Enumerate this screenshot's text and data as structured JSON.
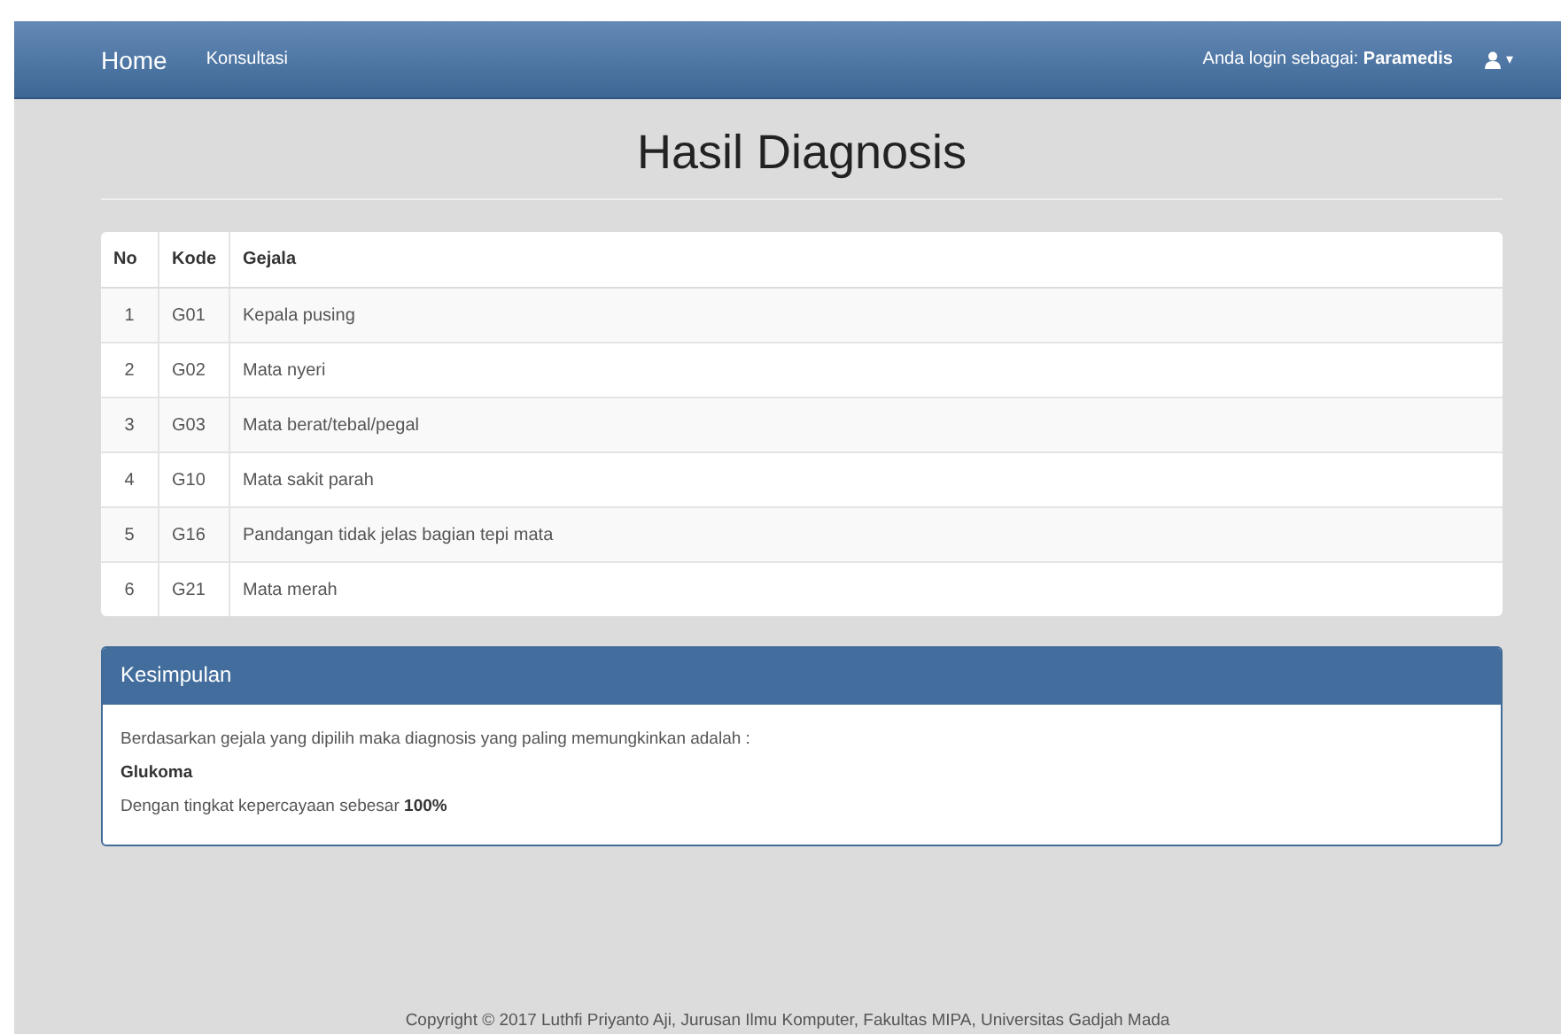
{
  "navbar": {
    "brand": "Home",
    "links": [
      {
        "label": "Konsultasi"
      }
    ],
    "login_label": "Anda login sebagai:",
    "login_user": "Paramedis",
    "user_menu": "▾"
  },
  "title": "Hasil Diagnosis",
  "table": {
    "columns": [
      "No",
      "Kode",
      "Gejala"
    ],
    "rows": [
      [
        "1",
        "G01",
        "Kepala pusing"
      ],
      [
        "2",
        "G02",
        "Mata nyeri"
      ],
      [
        "3",
        "G03",
        "Mata berat/tebal/pegal"
      ],
      [
        "4",
        "G10",
        "Mata sakit parah"
      ],
      [
        "5",
        "G16",
        "Pandangan tidak jelas bagian tepi mata"
      ],
      [
        "6",
        "G21",
        "Mata merah"
      ]
    ]
  },
  "panel": {
    "heading": "Kesimpulan",
    "lines": [
      "Berdasarkan gejala yang dipilih maka diagnosis yang paling memungkinkan adalah :",
      "Glukoma",
      "Dengan tingkat kepercayaan sebesar **100%**"
    ]
  },
  "footer": "Copyright © 2017 Luthfi Priyanto Aji, Jurusan Ilmu Komputer, Fakultas MIPA, Universitas Gadjah Mada"
}
